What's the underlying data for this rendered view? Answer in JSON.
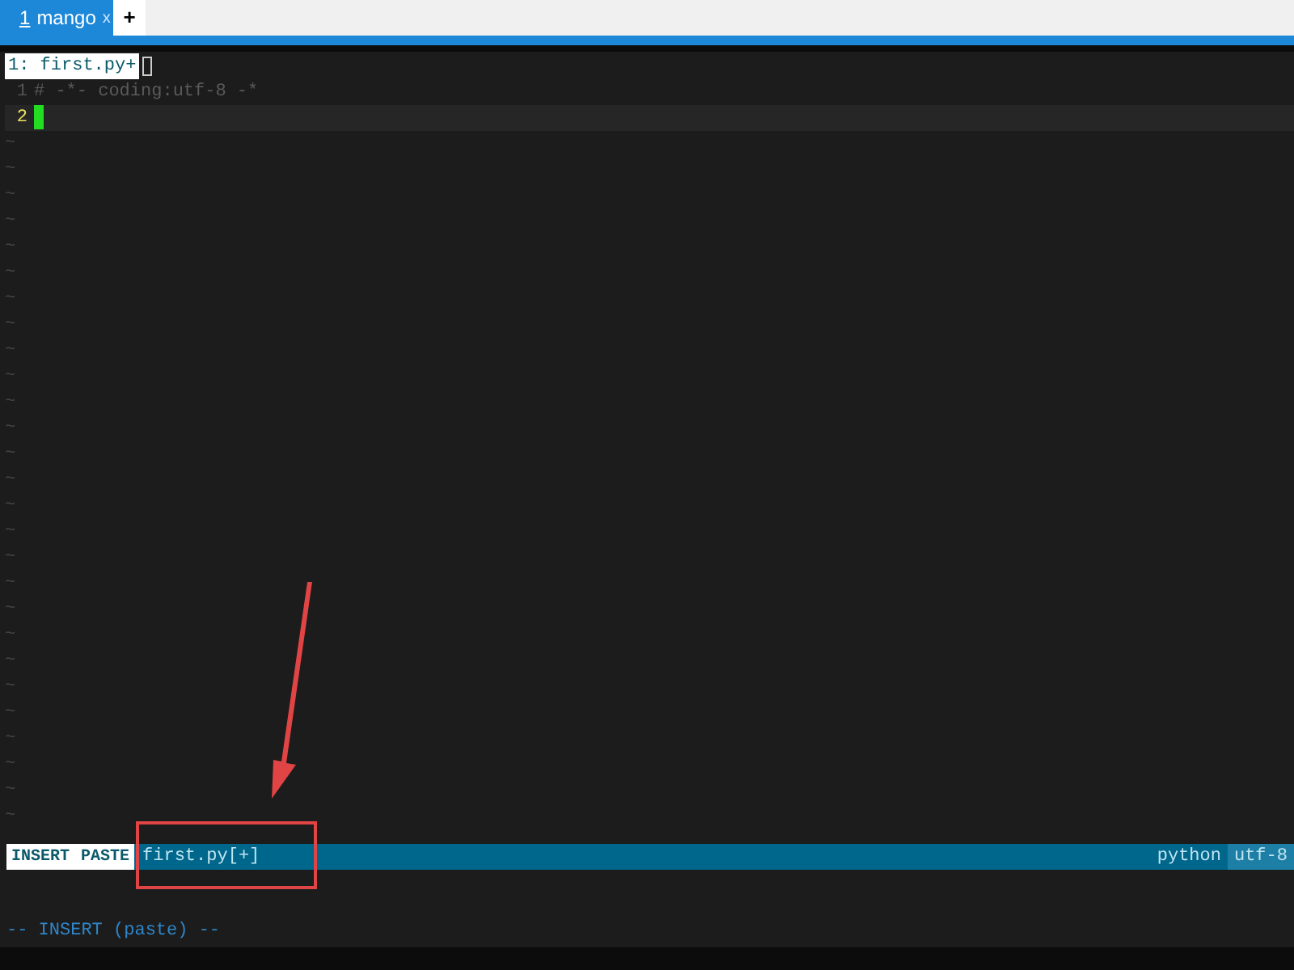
{
  "tabs": [
    {
      "number": "1",
      "label": "mango",
      "close": "x",
      "selected": true
    }
  ],
  "new_tab": "+",
  "buffer_tab": "1: first.py+",
  "lines": [
    {
      "number": "1",
      "text": "# -*- coding:utf-8 -*",
      "current": false
    },
    {
      "number": "2",
      "current": true
    }
  ],
  "empty_lines": [
    "~",
    "~",
    "~",
    "~",
    "~",
    "~",
    "~",
    "~",
    "~",
    "~",
    "~",
    "~",
    "~",
    "~",
    "~",
    "~",
    "~",
    "~",
    "~",
    "~",
    "~",
    "~",
    "~",
    "~",
    "~",
    "~",
    "~"
  ],
  "status_bar": {
    "modes": [
      "INSERT",
      "PASTE"
    ],
    "file": "first.py[+]",
    "filetype": "python",
    "encoding": "utf-8"
  },
  "message": "-- INSERT (paste) --"
}
